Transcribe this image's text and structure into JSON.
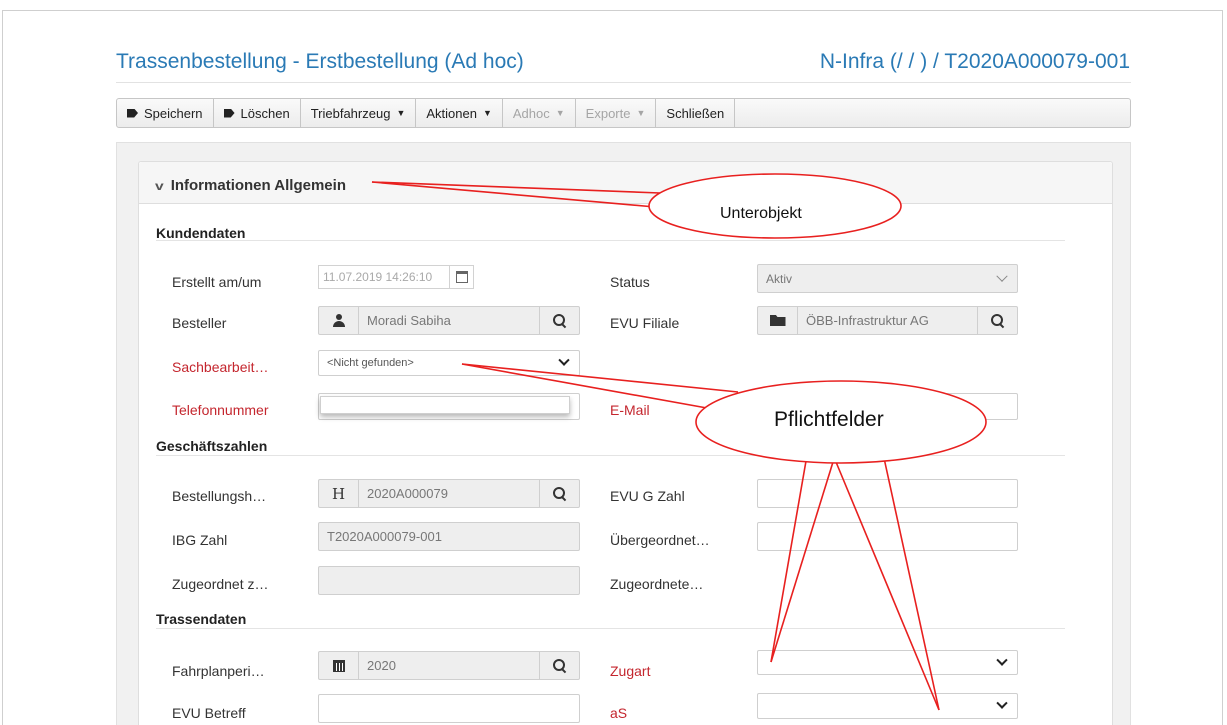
{
  "page": {
    "title": "Trassenbestellung - Erstbestellung (Ad hoc)",
    "reference": "N-Infra (/ / ) / T2020A000079-001"
  },
  "toolbar": {
    "save": "Speichern",
    "delete": "Löschen",
    "locomotive": "Triebfahrzeug",
    "actions": "Aktionen",
    "adhoc": "Adhoc",
    "exports": "Exporte",
    "close": "Schließen"
  },
  "section": {
    "title": "Informationen Allgemein"
  },
  "groups": {
    "customer": "Kundendaten",
    "business": "Geschäftszahlen",
    "path": "Trassendaten"
  },
  "labels": {
    "created": "Erstellt am/um",
    "status": "Status",
    "orderer": "Besteller",
    "evu_branch": "EVU Filiale",
    "clerk": "Sachbearbeit…",
    "phone": "Telefonnummer",
    "email": "E-Mail",
    "order_number": "Bestellungsh…",
    "evu_g_number": "EVU G Zahl",
    "ibg_number": "IBG Zahl",
    "parent": "Übergeordnet…",
    "assigned_to": "Zugeordnet z…",
    "assigned": "Zugeordnete…",
    "timetable_period": "Fahrplanperi…",
    "train_type": "Zugart",
    "evu_subject": "EVU Betreff",
    "as": "aS"
  },
  "values": {
    "created": "11.07.2019 14:26:10",
    "status": "Aktiv",
    "orderer": "Moradi Sabiha",
    "evu_branch": "ÖBB-Infrastruktur AG",
    "clerk": "<Nicht gefunden>",
    "order_prefix": "H",
    "order_number": "2020A000079",
    "ibg_number": "T2020A000079-001",
    "timetable_period": "2020"
  },
  "annotations": {
    "subobject": "Unterobjekt",
    "required_fields": "Pflichtfelder"
  },
  "colors": {
    "title_blue": "#2a7ab5",
    "required_red": "#c4262e",
    "callout_red": "#e8201f"
  }
}
